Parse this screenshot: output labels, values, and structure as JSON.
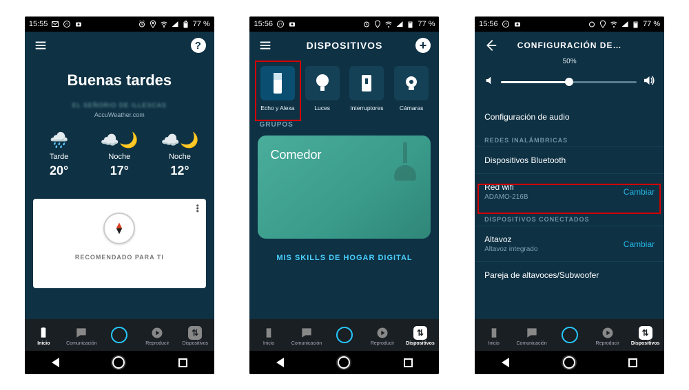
{
  "status": {
    "times": [
      "15:55",
      "15:56",
      "15:56"
    ],
    "battery": "77 %",
    "icons_left": [
      "mail-icon",
      "counter-77-icon",
      "camera-icon"
    ],
    "icons_right": [
      "alarm-icon",
      "location-icon",
      "wifi-icon",
      "signal-icon",
      "battery-icon"
    ]
  },
  "tabs": {
    "items": [
      {
        "id": "inicio",
        "label": "Inicio"
      },
      {
        "id": "comunicacion",
        "label": "Comunicación"
      },
      {
        "id": "alexa",
        "label": ""
      },
      {
        "id": "reproducir",
        "label": "Reproducir"
      },
      {
        "id": "dispositivos",
        "label": "Dispositivos"
      }
    ],
    "active": [
      "inicio",
      "dispositivos",
      "dispositivos"
    ]
  },
  "screen1": {
    "greeting": "Buenas tardes",
    "sub_blurred": "EL SEÑORIO DE ILLESCAS",
    "provider": "AccuWeather.com",
    "weather": [
      {
        "label": "Tarde",
        "temp": "20°",
        "icon": "rain-icon"
      },
      {
        "label": "Noche",
        "temp": "17°",
        "icon": "partly-cloudy-night-icon"
      },
      {
        "label": "Noche",
        "temp": "12°",
        "icon": "partly-cloudy-night-icon"
      }
    ],
    "card_label": "RECOMENDADO PARA TI"
  },
  "screen2": {
    "title": "DISPOSITIVOS",
    "devices": [
      {
        "label": "Echo y Alexa",
        "icon": "echo-icon",
        "selected": true
      },
      {
        "label": "Luces",
        "icon": "bulb-icon"
      },
      {
        "label": "Interruptores",
        "icon": "switch-icon"
      },
      {
        "label": "Cámaras",
        "icon": "camera-dev-icon"
      }
    ],
    "groups_label": "GRUPOS",
    "group_name": "Comedor",
    "skills_link": "MIS SKILLS DE HOGAR DIGITAL"
  },
  "screen3": {
    "title": "CONFIGURACIÓN DE…",
    "volume_pct": "50%",
    "volume_value": 50,
    "rows": {
      "audio": "Configuración de audio",
      "section_wireless": "REDES INALÁMBRICAS",
      "bluetooth": "Dispositivos Bluetooth",
      "wifi_label": "Red wifi",
      "wifi_value": "ADAMO-216B",
      "wifi_action": "Cambiar",
      "section_connected": "DISPOSITIVOS CONECTADOS",
      "speaker_label": "Altavoz",
      "speaker_value": "Altavoz integrado",
      "speaker_action": "Cambiar",
      "pair": "Pareja de altavoces/Subwoofer"
    }
  }
}
